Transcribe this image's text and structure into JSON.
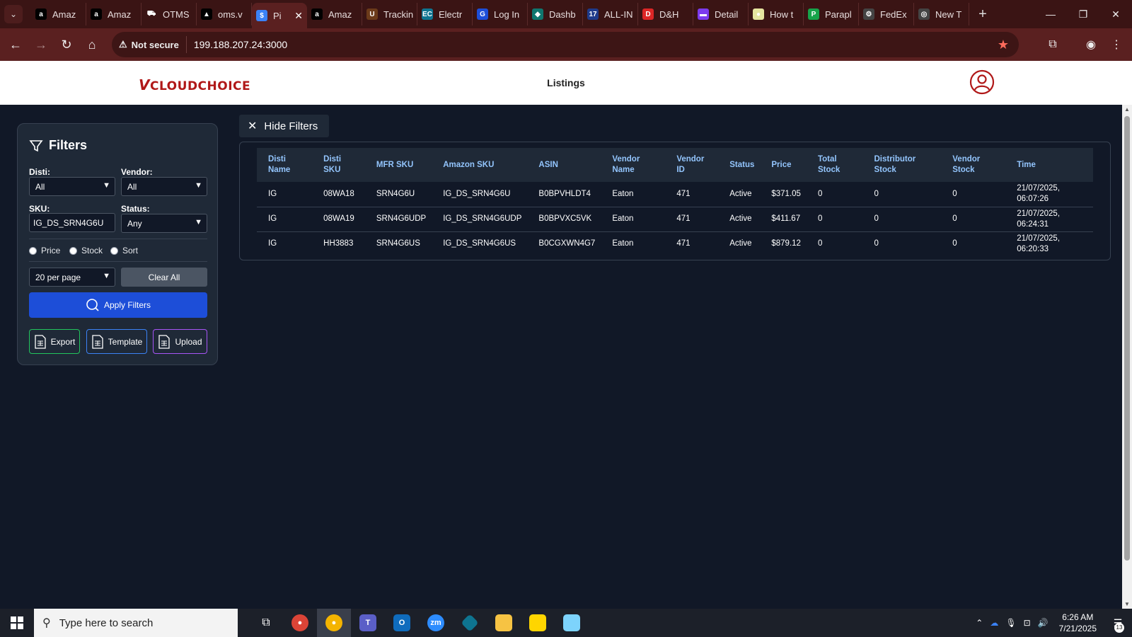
{
  "browser": {
    "tabs": [
      {
        "title": "Amaz",
        "fav_color": "#000000",
        "fav_glyph": "a",
        "icon": "amazon-icon"
      },
      {
        "title": "Amaz",
        "fav_color": "#000000",
        "fav_glyph": "a",
        "icon": "amazon-icon"
      },
      {
        "title": "OTMS",
        "fav_color": "#3a1414",
        "fav_glyph": "⛟",
        "icon": "otms-icon"
      },
      {
        "title": "oms.v",
        "fav_color": "#000000",
        "fav_glyph": "▲",
        "icon": "oms-icon"
      },
      {
        "title": "Pi",
        "fav_color": "#3b82f6",
        "fav_glyph": "$",
        "icon": "price-icon"
      },
      {
        "title": "Amaz",
        "fav_color": "#000000",
        "fav_glyph": "a",
        "icon": "amazon-icon"
      },
      {
        "title": "Trackin",
        "fav_color": "#6b3a1a",
        "fav_glyph": "U",
        "icon": "ups-icon"
      },
      {
        "title": "Electr",
        "fav_color": "#0e7490",
        "fav_glyph": "EC",
        "icon": "ec-icon"
      },
      {
        "title": "Log In",
        "fav_color": "#1d4ed8",
        "fav_glyph": "G",
        "icon": "login-icon"
      },
      {
        "title": "Dashb",
        "fav_color": "#0f766e",
        "fav_glyph": "◆",
        "icon": "dashboard-icon"
      },
      {
        "title": "ALL-IN",
        "fav_color": "#1e3a8a",
        "fav_glyph": "17",
        "icon": "allin-icon"
      },
      {
        "title": "D&H",
        "fav_color": "#dc2626",
        "fav_glyph": "D",
        "icon": "dh-icon"
      },
      {
        "title": "Detail",
        "fav_color": "#7c3aed",
        "fav_glyph": "▬",
        "icon": "detail-icon"
      },
      {
        "title": "How t",
        "fav_color": "#e5e5a0",
        "fav_glyph": "●",
        "icon": "howto-icon"
      },
      {
        "title": "Parapl",
        "fav_color": "#16a34a",
        "fav_glyph": "P",
        "icon": "paraplan-icon"
      },
      {
        "title": "FedEx",
        "fav_color": "#444444",
        "fav_glyph": "⚙",
        "icon": "fedex-icon"
      },
      {
        "title": "New T",
        "fav_color": "#444444",
        "fav_glyph": "◎",
        "icon": "newtab-icon"
      }
    ],
    "active_tab": 4,
    "not_secure": "Not secure",
    "url": "199.188.207.24:3000"
  },
  "app": {
    "logo_v": "V",
    "logo_text": "CLOUDCHOICE",
    "title": "Listings"
  },
  "filters": {
    "title": "Filters",
    "disti_label": "Disti:",
    "disti_value": "All",
    "vendor_label": "Vendor:",
    "vendor_value": "All",
    "sku_label": "SKU:",
    "sku_value": "IG_DS_SRN4G6U",
    "status_label": "Status:",
    "status_value": "Any",
    "radio_price": "Price",
    "radio_stock": "Stock",
    "radio_sort": "Sort",
    "per_page": "20 per page",
    "clear_all": "Clear All",
    "apply": "Apply Filters",
    "export": "Export",
    "template": "Template",
    "upload": "Upload"
  },
  "hide_filters": "Hide Filters",
  "table": {
    "headers": [
      "Disti Name",
      "Disti SKU",
      "MFR SKU",
      "Amazon SKU",
      "ASIN",
      "Vendor Name",
      "Vendor ID",
      "Status",
      "Price",
      "Total Stock",
      "Distributor Stock",
      "Vendor Stock",
      "Time"
    ],
    "rows": [
      [
        "IG",
        "08WA18",
        "SRN4G6U",
        "IG_DS_SRN4G6U",
        "B0BPVHLDT4",
        "Eaton",
        "471",
        "Active",
        "$371.05",
        "0",
        "0",
        "0",
        "21/07/2025, 06:07:26"
      ],
      [
        "IG",
        "08WA19",
        "SRN4G6UDP",
        "IG_DS_SRN4G6UDP",
        "B0BPVXC5VK",
        "Eaton",
        "471",
        "Active",
        "$411.67",
        "0",
        "0",
        "0",
        "21/07/2025, 06:24:31"
      ],
      [
        "IG",
        "HH3883",
        "SRN4G6US",
        "IG_DS_SRN4G6US",
        "B0CGXWN4G7",
        "Eaton",
        "471",
        "Active",
        "$879.12",
        "0",
        "0",
        "0",
        "21/07/2025, 06:20:33"
      ]
    ]
  },
  "taskbar": {
    "search_placeholder": "Type here to search",
    "time": "6:26 AM",
    "date": "7/21/2025",
    "notif_count": "13"
  }
}
